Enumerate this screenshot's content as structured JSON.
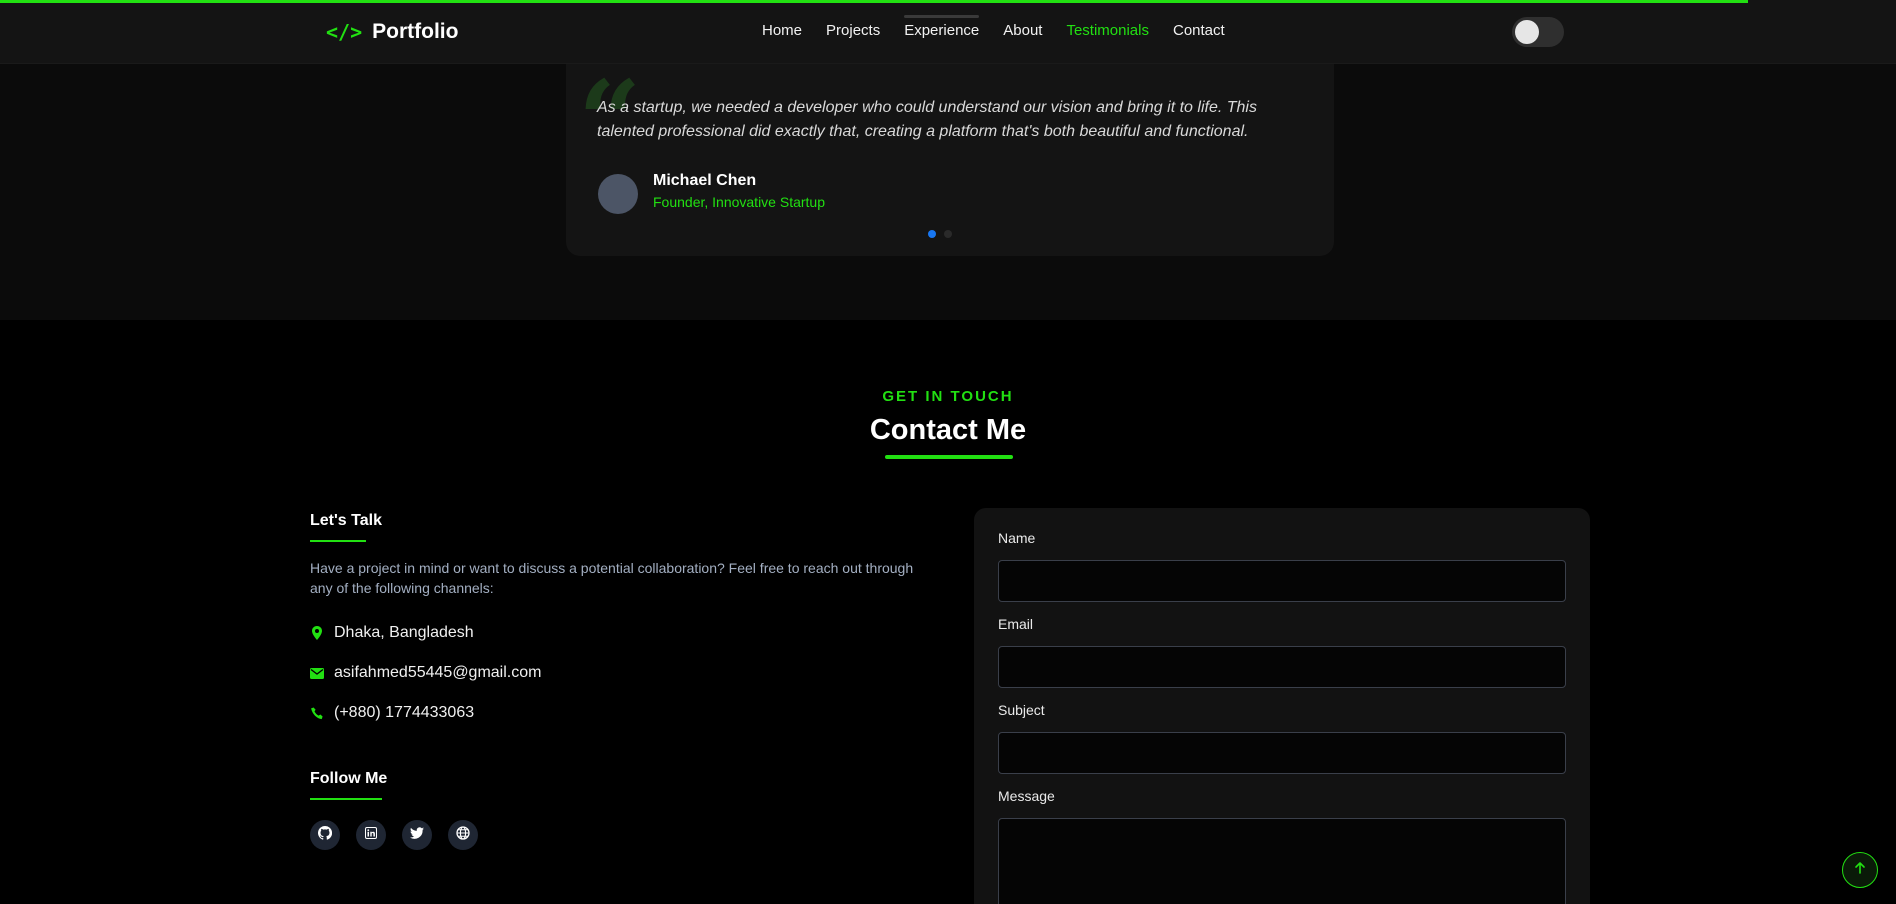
{
  "logo": {
    "mark": "</>",
    "text": "Portfolio"
  },
  "nav": {
    "items": [
      {
        "label": "Home"
      },
      {
        "label": "Projects"
      },
      {
        "label": "Experience"
      },
      {
        "label": "About"
      },
      {
        "label": "Testimonials",
        "active": true
      },
      {
        "label": "Contact"
      }
    ]
  },
  "progress": {
    "percent": 92
  },
  "theme_toggle": {
    "state": "off"
  },
  "testimonial": {
    "quote": "As a startup, we needed a developer who could understand our vision and bring it to life. This talented professional did exactly that, creating a platform that's both beautiful and functional.",
    "author_name": "Michael Chen",
    "author_role": "Founder, Innovative Startup",
    "active_dot": 1,
    "dot_count": 2
  },
  "contact": {
    "eyebrow": "GET IN TOUCH",
    "title": "Contact Me",
    "lets_talk_heading": "Let's Talk",
    "intro": "Have a project in mind or want to discuss a potential collaboration? Feel free to reach out through any of the following channels:",
    "location": "Dhaka, Bangladesh",
    "email": "asifahmed55445@gmail.com",
    "phone": "(+880) 1774433063",
    "follow_heading": "Follow Me",
    "socials": [
      "github-icon",
      "linkedin-icon",
      "twitter-icon",
      "globe-icon"
    ]
  },
  "form": {
    "name_label": "Name",
    "email_label": "Email",
    "subject_label": "Subject",
    "message_label": "Message",
    "name_value": "",
    "email_value": "",
    "subject_value": "",
    "message_value": ""
  },
  "colors": {
    "accent": "#22e012",
    "background": "#000000",
    "card": "#141414",
    "active_dot": "#1877f2"
  }
}
